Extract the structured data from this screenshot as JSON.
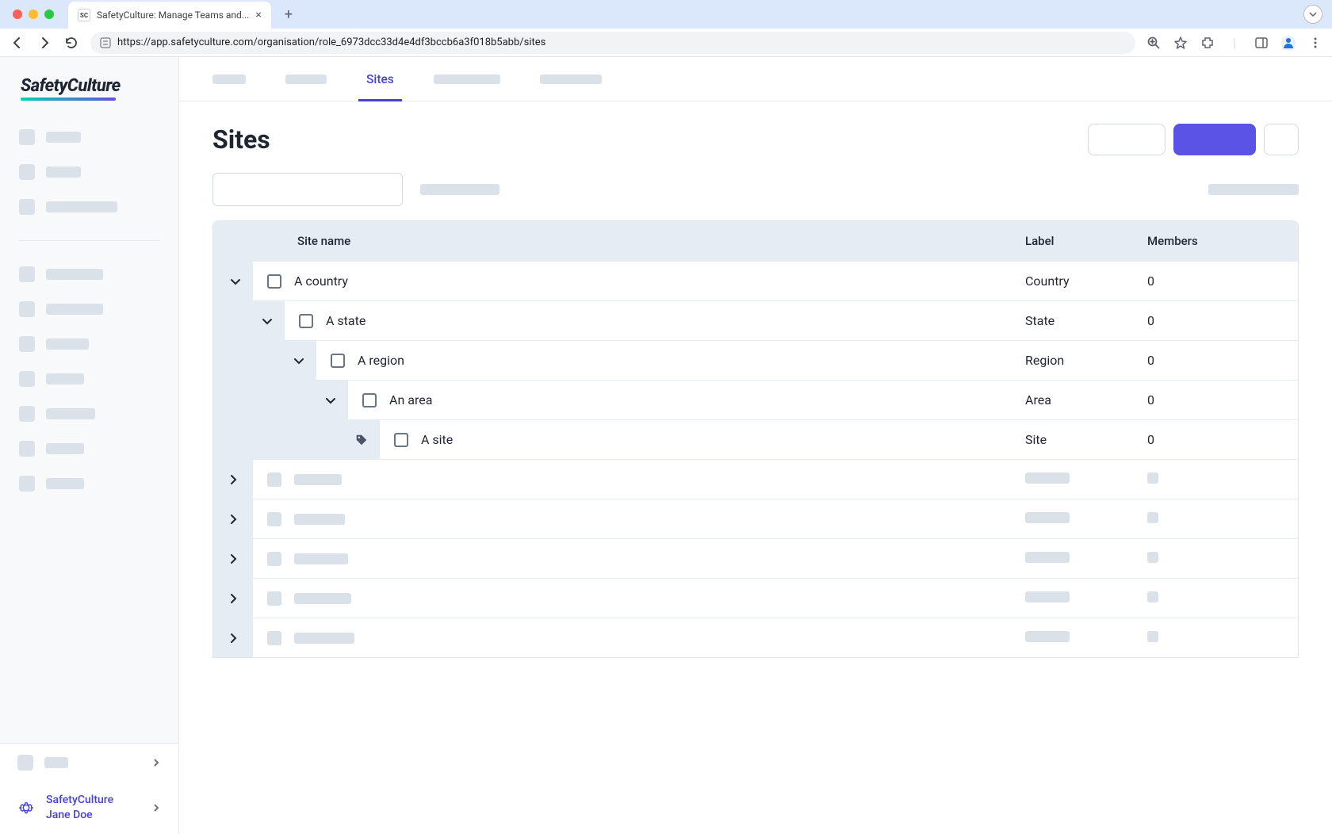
{
  "browser": {
    "tab_title": "SafetyCulture: Manage Teams and...",
    "url": "https://app.safetyculture.com/organisation/role_6973dcc33d4e4df3bccb6a3f018b5abb/sites"
  },
  "logo": "SafetyCulture",
  "tabs": {
    "active_label": "Sites"
  },
  "page": {
    "title": "Sites"
  },
  "table": {
    "headers": {
      "name": "Site name",
      "label": "Label",
      "members": "Members"
    },
    "rows": [
      {
        "depth": 0,
        "name": "A country",
        "label": "Country",
        "members": "0",
        "expanded": true,
        "leaf": false
      },
      {
        "depth": 1,
        "name": "A state",
        "label": "State",
        "members": "0",
        "expanded": true,
        "leaf": false
      },
      {
        "depth": 2,
        "name": "A region",
        "label": "Region",
        "members": "0",
        "expanded": true,
        "leaf": false
      },
      {
        "depth": 3,
        "name": "An area",
        "label": "Area",
        "members": "0",
        "expanded": true,
        "leaf": false
      },
      {
        "depth": 4,
        "name": "A site",
        "label": "Site",
        "members": "0",
        "expanded": false,
        "leaf": true
      }
    ]
  },
  "user": {
    "org": "SafetyCulture",
    "name": "Jane Doe"
  }
}
